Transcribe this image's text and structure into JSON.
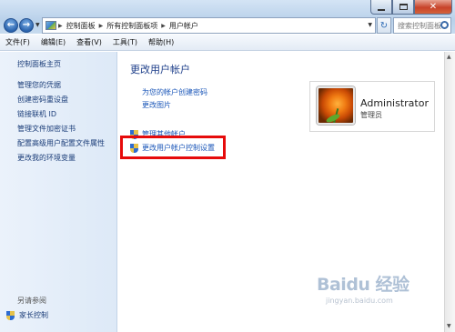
{
  "window": {
    "breadcrumb": [
      "控制面板",
      "所有控制面板项",
      "用户帐户"
    ],
    "search_placeholder": "搜索控制面板",
    "refresh_icon": "refresh-icon"
  },
  "menubar": {
    "items": [
      "文件(F)",
      "编辑(E)",
      "查看(V)",
      "工具(T)",
      "帮助(H)"
    ]
  },
  "sidebar": {
    "home": "控制面板主页",
    "links": [
      "管理您的凭据",
      "创建密码重设盘",
      "链接联机 ID",
      "管理文件加密证书",
      "配置高级用户配置文件属性",
      "更改我的环境变量"
    ],
    "see_also": "另请参阅",
    "parental": "家长控制"
  },
  "main": {
    "title": "更改用户帐户",
    "links": [
      "为您的帐户创建密码",
      "更改图片"
    ],
    "shield_links": [
      "管理其他帐户",
      "更改用户帐户控制设置"
    ],
    "highlight_color": "#e60b0b"
  },
  "user": {
    "name": "Administrator",
    "role": "管理员"
  },
  "watermark": {
    "logo": "Baidu 经验",
    "url": "jingyan.baidu.com"
  }
}
